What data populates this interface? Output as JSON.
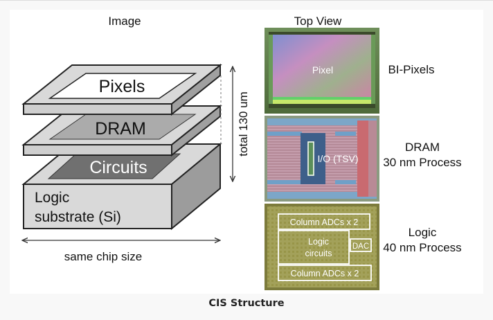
{
  "caption": "CIS Structure",
  "headings": {
    "left": "Image",
    "right": "Top View"
  },
  "layers": {
    "pixels": "Pixels",
    "dram": "DRAM",
    "circuits": "Circuits",
    "logic_line1": "Logic",
    "logic_line2": "substrate (Si)"
  },
  "dimension_labels": {
    "height": "total 130 um",
    "width": "same chip size"
  },
  "die_photos": {
    "pixel": {
      "label": "Pixel"
    },
    "dram": {
      "label": "I/O (TSV)"
    },
    "logic": {
      "block_top": "Column ADCs x 2",
      "block_center_line1": "Logic",
      "block_center_line2": "circuits",
      "block_dac": "DAC",
      "block_bottom": "Column ADCs x 2"
    }
  },
  "side_labels": {
    "bi_pixels": "BI-Pixels",
    "dram_line1": "DRAM",
    "dram_line2": "30 nm Process",
    "logic_line1": "Logic",
    "logic_line2": "40 nm Process"
  },
  "colors": {
    "layer_face": "#d9d9d9",
    "layer_dark": "#6e6e6e",
    "layer_mid": "#aaaaaa",
    "dram_die": "#b58f9c",
    "logic_die": "#9a9a55"
  }
}
